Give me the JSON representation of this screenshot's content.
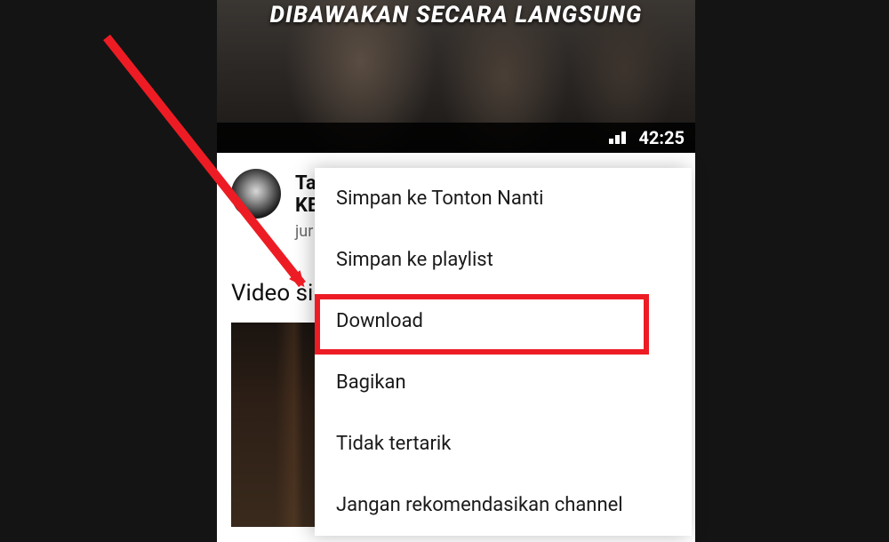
{
  "video": {
    "caption": "DIBAWAKAN SECARA LANGSUNG",
    "duration": "42:25"
  },
  "meta": {
    "title_line1": "Ta",
    "title_line2": "KE",
    "subtitle": "jur"
  },
  "section_header": "Video sir",
  "menu": {
    "items": [
      "Simpan ke Tonton Nanti",
      "Simpan ke playlist",
      "Download",
      "Bagikan",
      "Tidak tertarik",
      "Jangan rekomendasikan channel"
    ]
  }
}
